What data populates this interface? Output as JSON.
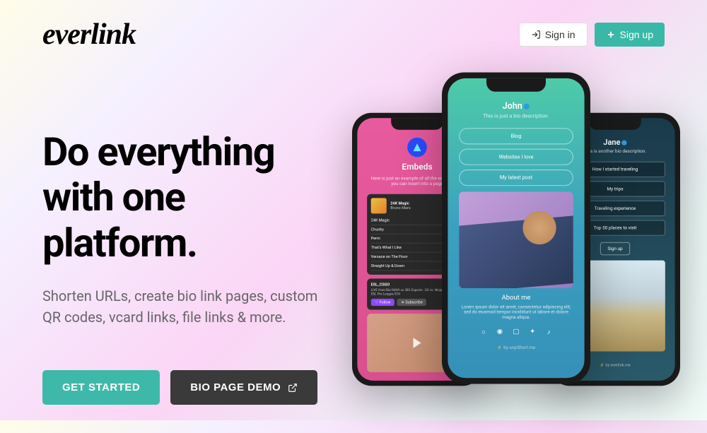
{
  "header": {
    "logo": "everlink",
    "signin": "Sign in",
    "signup": "Sign up"
  },
  "hero": {
    "title": "Do everything with one platform.",
    "subtitle": "Shorten URLs, create bio link pages, custom QR codes, vcard links, file links & more.",
    "cta_primary": "GET STARTED",
    "cta_secondary": "BIO PAGE DEMO"
  },
  "phones": {
    "left": {
      "title": "Embeds",
      "embed_title": "24K Magic",
      "embed_artist": "Bruno Mars",
      "tracks": [
        "24K Magic",
        "Chunky",
        "Perm",
        "That's What I Like",
        "Versace on The Floor",
        "Straight Up & Down"
      ],
      "video_title": "ESL_CSGO"
    },
    "center": {
      "name": "John",
      "desc": "This is just a bio description.",
      "links": [
        "Blog",
        "Websites I love",
        "My latest post"
      ],
      "about": "About me"
    },
    "right": {
      "name": "Jane",
      "desc": "This is another bio description.",
      "links": [
        "How I started traveling",
        "My trips",
        "Traveling experience",
        "Top 50 places to visit"
      ],
      "signup": "Sign up"
    }
  }
}
